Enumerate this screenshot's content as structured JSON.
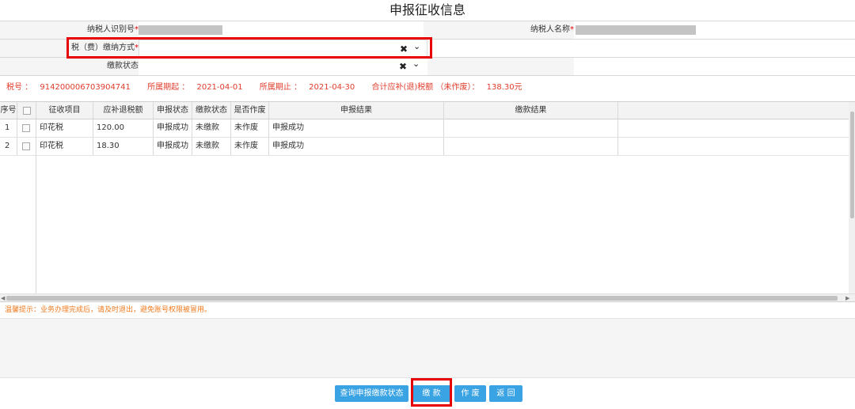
{
  "title": "申报征收信息",
  "form": {
    "taxpayer_id_label": "纳税人识别号",
    "taxpayer_name_label": "纳税人名称",
    "payment_method_label": "税（费）缴纳方式",
    "payment_method_value": "",
    "payment_status_label": "缴款状态",
    "payment_status_value": "",
    "required_mark": "*",
    "clear_glyph": "✖",
    "dropdown_glyph": "⌄"
  },
  "summary": {
    "tax_no_label": "税号 ：",
    "tax_no_value": "914200006703904741",
    "period_start_label": "所属期起 ：",
    "period_start_value": "2021-04-01",
    "period_end_label": "所属期止 ：",
    "period_end_value": "2021-04-30",
    "total_label": "合计应补(退)税额 （未作废）：",
    "total_value": "138.30元"
  },
  "table": {
    "headers": [
      "序号",
      "",
      "征收项目",
      "应补退税额",
      "申报状态",
      "缴款状态",
      "是否作废",
      "申报结果",
      "缴款结果"
    ],
    "rows": [
      {
        "no": "1",
        "item": "印花税",
        "amount": "120.00",
        "declare_status": "申报成功",
        "pay_status": "未缴款",
        "voided": "未作废",
        "declare_result": "申报成功",
        "pay_result": ""
      },
      {
        "no": "2",
        "item": "印花税",
        "amount": "18.30",
        "declare_status": "申报成功",
        "pay_status": "未缴款",
        "voided": "未作废",
        "declare_result": "申报成功",
        "pay_result": ""
      }
    ]
  },
  "tip": "温馨提示：业务办理完成后，请及时退出，避免账号权限被冒用。",
  "buttons": {
    "query_status": "查询申报缴款状态",
    "pay": "缴 款",
    "void": "作 废",
    "back": "返 回"
  },
  "colors": {
    "accent_button": "#3aa3e3",
    "highlight_box": "#e60000",
    "summary_text": "#e23c2c",
    "tip_text": "#ef7a1e"
  }
}
